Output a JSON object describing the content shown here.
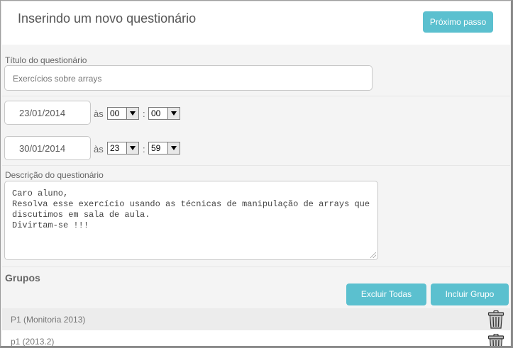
{
  "header": {
    "title": "Inserindo um novo questionário",
    "next_button": "Próximo passo"
  },
  "form": {
    "title_label": "Título do questionário",
    "title_value": "Exercícios sobre arrays",
    "start": {
      "date": "23/01/2014",
      "as": "às",
      "hour": "00",
      "minute": "00"
    },
    "end": {
      "date": "30/01/2014",
      "as": "às",
      "hour": "23",
      "minute": "59"
    },
    "time_separator": ":",
    "description_label": "Descrição do questionário",
    "description_lines": [
      "Caro aluno,",
      "Resolva esse exercício usando as técnicas de manipulação de arrays que",
      "discutimos em sala de aula.",
      "Divirtam-se !!!"
    ]
  },
  "groups": {
    "title": "Grupos",
    "delete_all_button": "Excluir Todas",
    "add_group_button": "Incluir Grupo",
    "items": [
      {
        "name": "P1 (Monitoria 2013)"
      },
      {
        "name": "p1 (2013.2)"
      }
    ]
  },
  "colors": {
    "accent": "#5bc0cf",
    "background": "#f4f4f4"
  },
  "icons": {
    "delete": "trash-icon",
    "dropdown": "chevron-down-icon",
    "resize": "resize-grip-icon"
  }
}
